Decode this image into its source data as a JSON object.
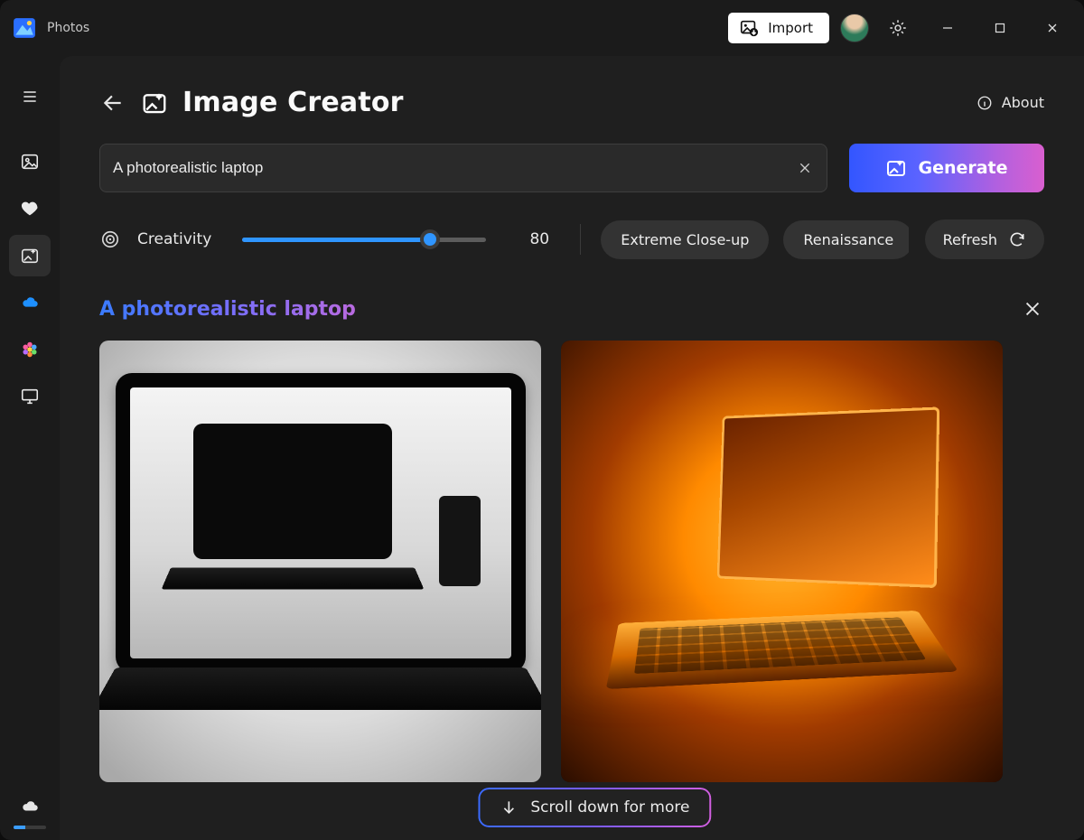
{
  "titlebar": {
    "app_title": "Photos",
    "import_label": "Import"
  },
  "sidebar": {
    "items": [
      {
        "name": "menu"
      },
      {
        "name": "gallery"
      },
      {
        "name": "favorites"
      },
      {
        "name": "image-creator"
      },
      {
        "name": "onedrive"
      },
      {
        "name": "icloud"
      },
      {
        "name": "devices"
      }
    ],
    "active_index": 3
  },
  "header": {
    "page_title": "Image Creator",
    "about_label": "About"
  },
  "prompt": {
    "value": "A photorealistic laptop",
    "generate_label": "Generate"
  },
  "controls": {
    "creativity_label": "Creativity",
    "creativity_value": "80",
    "creativity_percent": 77,
    "suggestions": [
      "Extreme Close-up",
      "Renaissance"
    ],
    "refresh_label": "Refresh"
  },
  "results": {
    "title": "A photorealistic laptop"
  },
  "scroll_more_label": "Scroll down for more"
}
